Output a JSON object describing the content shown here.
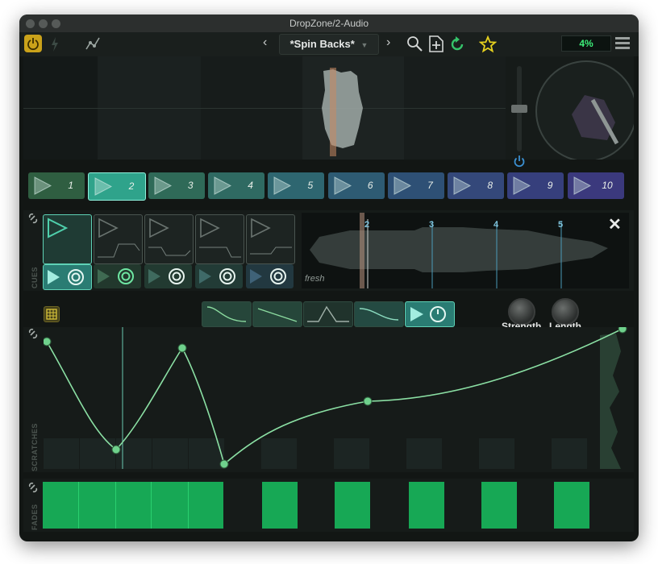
{
  "window": {
    "title": "DropZone/2-Audio"
  },
  "toolbar": {
    "preset_name": "*Spin Backs*",
    "prev_label": "‹",
    "next_label": "›",
    "cpu_meter": "4%"
  },
  "trigger_pads": [
    {
      "label": "1",
      "color": "#2f5e41"
    },
    {
      "label": "2",
      "color": "#2fa38b"
    },
    {
      "label": "3",
      "color": "#2f6a58"
    },
    {
      "label": "4",
      "color": "#2f6a62"
    },
    {
      "label": "5",
      "color": "#2e6670"
    },
    {
      "label": "6",
      "color": "#2e5b73"
    },
    {
      "label": "7",
      "color": "#2e5075"
    },
    {
      "label": "8",
      "color": "#34487a"
    },
    {
      "label": "9",
      "color": "#363f7c"
    },
    {
      "label": "10",
      "color": "#3b397d"
    }
  ],
  "cues": {
    "section_label": "CUES",
    "sample_name": "fresh",
    "markers": [
      "2",
      "3",
      "4",
      "5"
    ],
    "close_label": "✕"
  },
  "scratch_controls": {
    "knobs": [
      {
        "label": "Strength"
      },
      {
        "label": "Length"
      }
    ]
  },
  "scratches": {
    "section_label": "SCRATCHES"
  },
  "fades": {
    "section_label": "FADES"
  }
}
